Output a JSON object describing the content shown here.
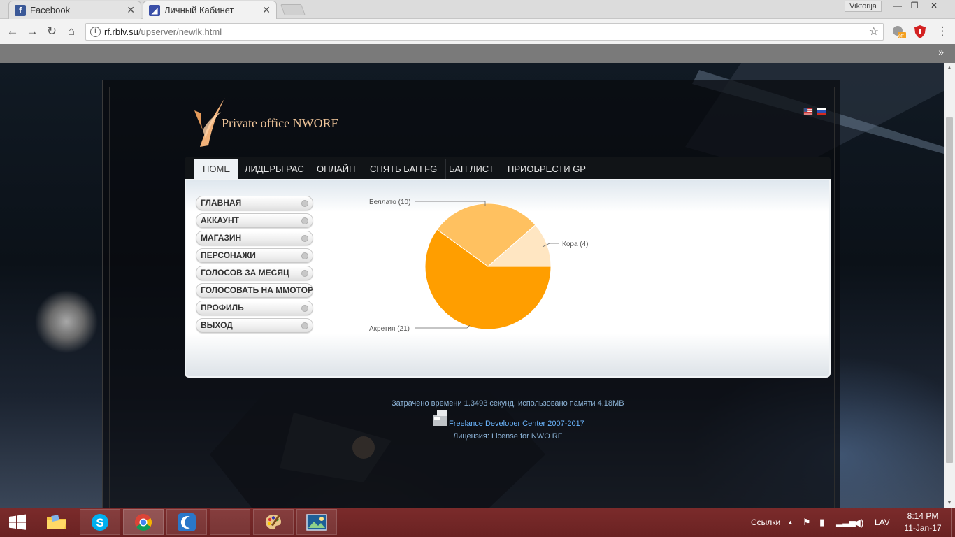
{
  "browser": {
    "tabs": [
      {
        "title": "Facebook",
        "active": false
      },
      {
        "title": "Личный Кабинет",
        "active": true
      }
    ],
    "profile_name": "Viktorija",
    "url_host": "rf.rblv.su",
    "url_path": "/upserver/newlk.html",
    "bookmarks_overflow": "»",
    "extension_badge": "off"
  },
  "site": {
    "title": "Private office NWORF",
    "nav": [
      "HOME",
      "ЛИДЕРЫ РАС",
      "ОНЛАЙН",
      "СНЯТЬ БАН FG",
      "БАН ЛИСТ",
      "ПРИОБРЕСТИ GP"
    ],
    "side_menu": [
      "ГЛАВНАЯ",
      "АККАУНТ",
      "МАГАЗИН",
      "ПЕРСОНАЖИ",
      "ГОЛОСОВ ЗА МЕСЯЦ",
      "ГОЛОСОВАТЬ НА MMOTOP",
      "ПРОФИЛЬ",
      "ВЫХОД"
    ]
  },
  "chart_data": {
    "type": "pie",
    "slices": [
      {
        "label": "Беллато (10)",
        "value": 10,
        "color": "#FFC160"
      },
      {
        "label": "Кора (4)",
        "value": 4,
        "color": "#FFE6C2"
      },
      {
        "label": "Акретия (21)",
        "value": 21,
        "color": "#FF9E00"
      }
    ]
  },
  "footer": {
    "stats": "Затрачено времени 1.3493 секунд, использовано памяти 4.18MB",
    "developer": "Freelance Developer Center 2007-2017",
    "license_label": "Лицензия:",
    "license_value": "License for NWO RF"
  },
  "taskbar": {
    "links_label": "Ссылки",
    "language": "LAV",
    "time": "8:14 PM",
    "date": "11-Jan-17"
  },
  "colors": {
    "accent_orange": "#FF9E00",
    "taskbar": "#6A2222",
    "footer_link": "#6CB6FF"
  }
}
